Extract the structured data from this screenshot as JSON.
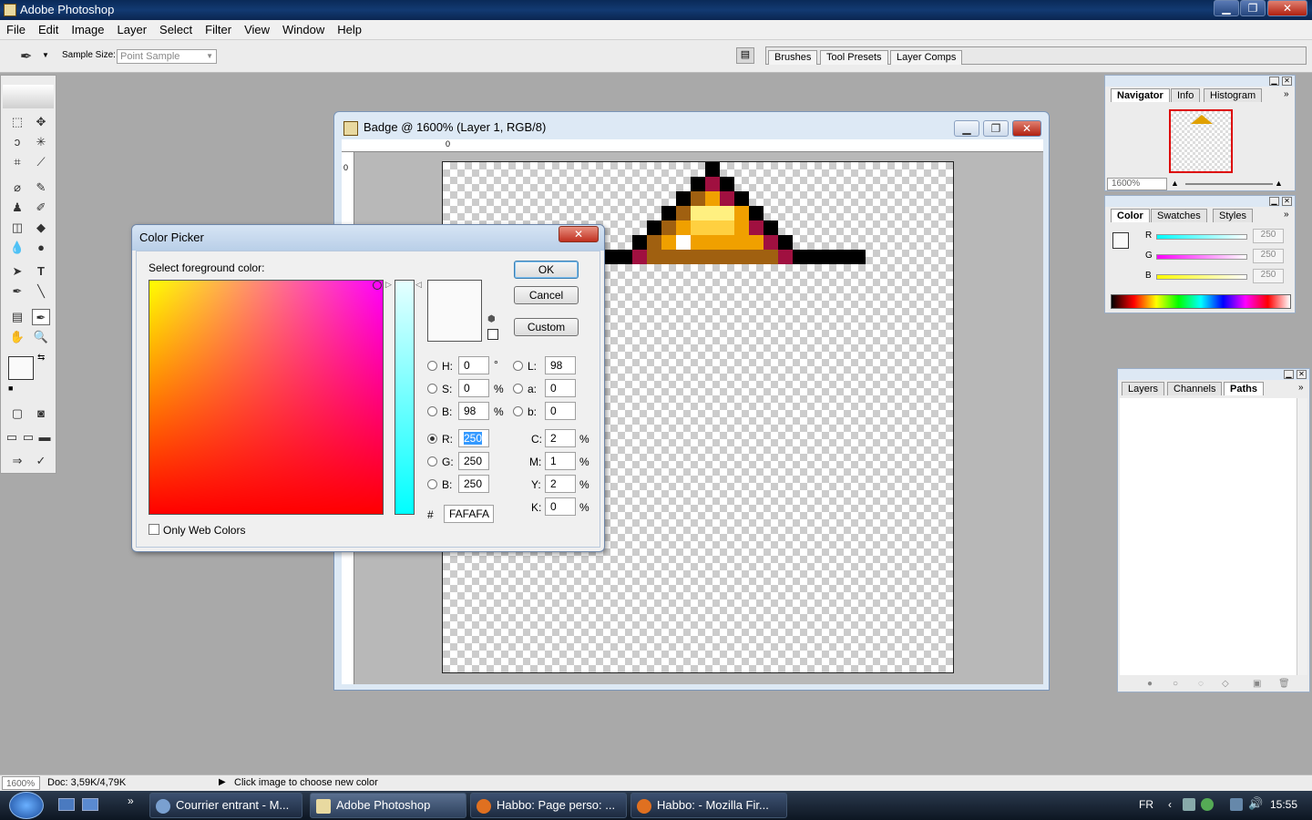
{
  "app": {
    "title": "Adobe Photoshop"
  },
  "menu": [
    "File",
    "Edit",
    "Image",
    "Layer",
    "Select",
    "Filter",
    "View",
    "Window",
    "Help"
  ],
  "options": {
    "sample_size_label": "Sample Size:",
    "sample_size_value": "Point Sample"
  },
  "well_tabs": [
    "Brushes",
    "Tool Presets",
    "Layer Comps"
  ],
  "document": {
    "title": "Badge @ 1600% (Layer 1, RGB/8)",
    "ruler_zero": "0"
  },
  "dialog": {
    "title": "Color Picker",
    "prompt": "Select foreground color:",
    "ok": "OK",
    "cancel": "Cancel",
    "custom": "Custom",
    "only_web": "Only Web Colors",
    "hsb": {
      "h_label": "H:",
      "h": "0",
      "h_unit": "°",
      "s_label": "S:",
      "s": "0",
      "s_unit": "%",
      "b_label": "B:",
      "b": "98",
      "b_unit": "%"
    },
    "rgb": {
      "r_label": "R:",
      "r": "250",
      "g_label": "G:",
      "g": "250",
      "b_label": "B:",
      "b": "250"
    },
    "lab": {
      "l_label": "L:",
      "l": "98",
      "a_label": "a:",
      "a": "0",
      "b_label": "b:",
      "b": "0"
    },
    "cmyk": {
      "c_label": "C:",
      "c": "2",
      "m_label": "M:",
      "m": "1",
      "y_label": "Y:",
      "y": "2",
      "k_label": "K:",
      "k": "0",
      "unit": "%"
    },
    "hex_label": "#",
    "hex": "FAFAFA",
    "new_color": "#fafafa"
  },
  "navigator": {
    "tabs": [
      "Navigator",
      "Info",
      "Histogram"
    ],
    "zoom": "1600%"
  },
  "color_panel": {
    "tabs": [
      "Color",
      "Swatches",
      "Styles"
    ],
    "r_label": "R",
    "r": "250",
    "g_label": "G",
    "g": "250",
    "b_label": "B",
    "b": "250"
  },
  "layers_panel": {
    "tabs": [
      "Layers",
      "Channels",
      "Paths"
    ]
  },
  "status": {
    "zoom": "1600%",
    "doc": "Doc: 3,59K/4,79K",
    "hint": "Click image to choose new color"
  },
  "taskbar": {
    "tasks": [
      "Courrier entrant - M...",
      "Adobe Photoshop",
      "Habbo: Page perso: ...",
      "Habbo: - Mozilla Fir..."
    ],
    "lang": "FR",
    "clock": "15:55"
  }
}
